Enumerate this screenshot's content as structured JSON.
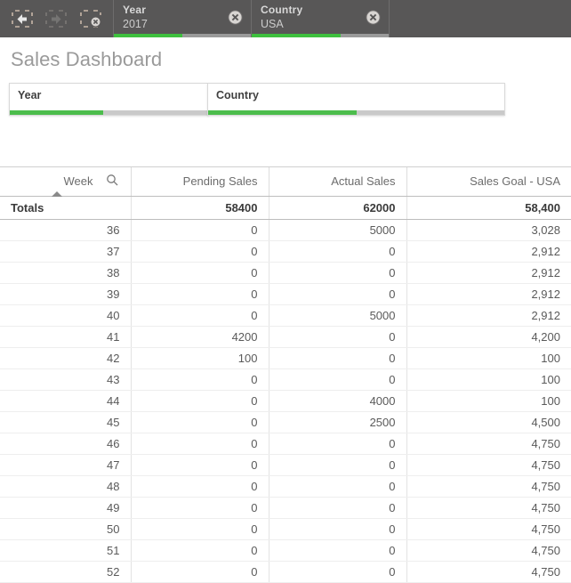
{
  "selection_bar": {
    "tools": [
      {
        "name": "selection-back",
        "label": "Step back in selections",
        "enabled": true
      },
      {
        "name": "selection-forward",
        "label": "Step forward in selections",
        "enabled": false
      },
      {
        "name": "clear-all-selections",
        "label": "Clear all selections",
        "enabled": true
      }
    ],
    "chips": [
      {
        "field": "Year",
        "value": "2017",
        "meter_percent": 50
      },
      {
        "field": "Country",
        "value": "USA",
        "meter_percent": 65
      }
    ],
    "clear_icon": "clear-selection-icon"
  },
  "sheet": {
    "title": "Sales Dashboard"
  },
  "filters": [
    {
      "title": "Year",
      "meter_percent": 47
    },
    {
      "title": "Country",
      "meter_percent": 50
    }
  ],
  "table": {
    "search_icon": "search-icon",
    "sort_indicator": "sort-ascending-icon",
    "columns": [
      {
        "label": "Week",
        "type": "dimension"
      },
      {
        "label": "Pending Sales",
        "type": "measure"
      },
      {
        "label": "Actual Sales",
        "type": "measure"
      },
      {
        "label": "Sales Goal - USA",
        "type": "measure"
      }
    ],
    "totals": {
      "label": "Totals",
      "values": [
        "58400",
        "62000",
        "58,400"
      ]
    },
    "rows": [
      {
        "week": "36",
        "pending": "0",
        "actual": "5000",
        "goal": "3,028"
      },
      {
        "week": "37",
        "pending": "0",
        "actual": "0",
        "goal": "2,912"
      },
      {
        "week": "38",
        "pending": "0",
        "actual": "0",
        "goal": "2,912"
      },
      {
        "week": "39",
        "pending": "0",
        "actual": "0",
        "goal": "2,912"
      },
      {
        "week": "40",
        "pending": "0",
        "actual": "5000",
        "goal": "2,912"
      },
      {
        "week": "41",
        "pending": "4200",
        "actual": "0",
        "goal": "4,200"
      },
      {
        "week": "42",
        "pending": "100",
        "actual": "0",
        "goal": "100"
      },
      {
        "week": "43",
        "pending": "0",
        "actual": "0",
        "goal": "100"
      },
      {
        "week": "44",
        "pending": "0",
        "actual": "4000",
        "goal": "100"
      },
      {
        "week": "45",
        "pending": "0",
        "actual": "2500",
        "goal": "4,500"
      },
      {
        "week": "46",
        "pending": "0",
        "actual": "0",
        "goal": "4,750"
      },
      {
        "week": "47",
        "pending": "0",
        "actual": "0",
        "goal": "4,750"
      },
      {
        "week": "48",
        "pending": "0",
        "actual": "0",
        "goal": "4,750"
      },
      {
        "week": "49",
        "pending": "0",
        "actual": "0",
        "goal": "4,750"
      },
      {
        "week": "50",
        "pending": "0",
        "actual": "0",
        "goal": "4,750"
      },
      {
        "week": "51",
        "pending": "0",
        "actual": "0",
        "goal": "4,750"
      },
      {
        "week": "52",
        "pending": "0",
        "actual": "0",
        "goal": "4,750"
      }
    ]
  },
  "colors": {
    "toolbar_bg": "#585757",
    "selection_green": "#3ec03e",
    "filter_green": "#4cbd4c",
    "title_gray": "#9a9a9a"
  }
}
